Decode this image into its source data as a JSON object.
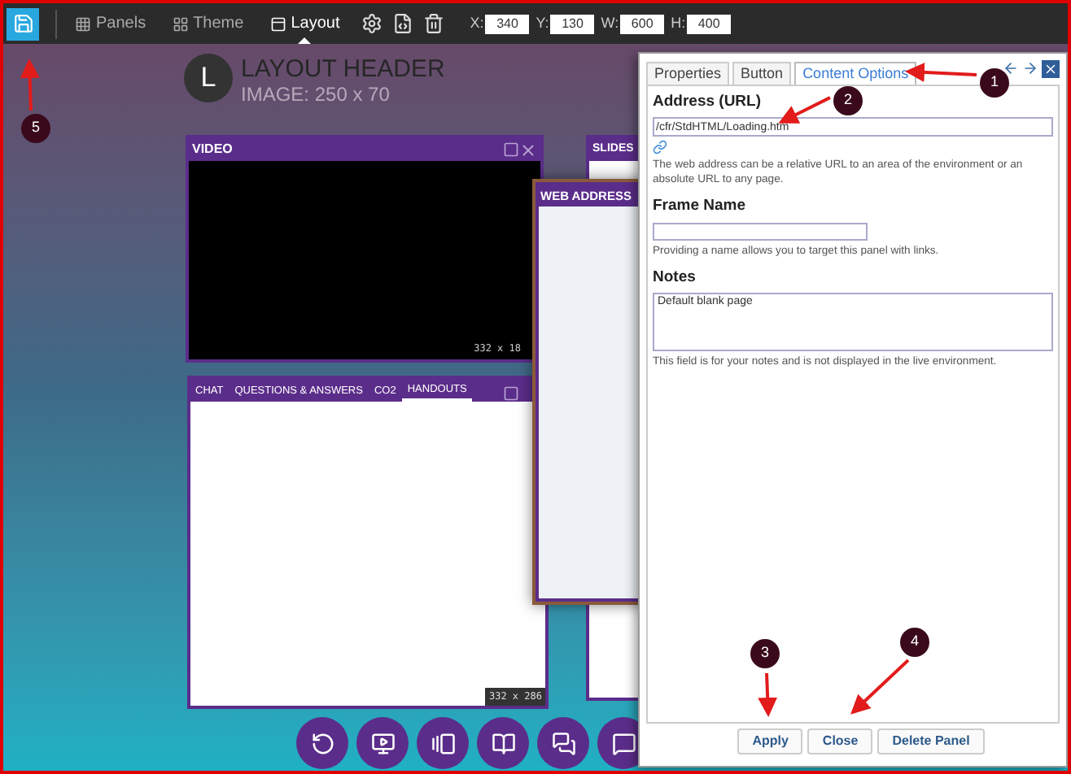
{
  "toolbar": {
    "tabs": [
      {
        "label": "Panels",
        "selected": false
      },
      {
        "label": "Theme",
        "selected": false
      },
      {
        "label": "Layout",
        "selected": true
      }
    ],
    "fields": [
      {
        "label": "X:",
        "value": "340"
      },
      {
        "label": "Y:",
        "value": "130"
      },
      {
        "label": "W:",
        "value": "600"
      },
      {
        "label": "H:",
        "value": "400"
      }
    ]
  },
  "header": {
    "logo_letter": "L",
    "title": "LAYOUT HEADER",
    "subtitle": "IMAGE: 250 x 70"
  },
  "video_panel": {
    "title": "VIDEO",
    "size": "332 x 18"
  },
  "chat_panel": {
    "tabs": [
      {
        "label": "CHAT",
        "selected": false
      },
      {
        "label": "QUESTIONS & ANSWERS",
        "selected": false
      },
      {
        "label": "CO2",
        "selected": false
      },
      {
        "label": "HANDOUTS",
        "selected": true
      }
    ],
    "size": "332 x 286"
  },
  "slides_panel": {
    "title": "SLIDES"
  },
  "web_address_panel": {
    "title": "WEB ADDRESS"
  },
  "dialog": {
    "tabs": [
      {
        "label": "Properties",
        "selected": false
      },
      {
        "label": "Button",
        "selected": false
      },
      {
        "label": "Content Options",
        "selected": true
      }
    ],
    "address": {
      "label": "Address (URL)",
      "value": "/cfr/StdHTML/Loading.htm",
      "help": "The web address can be a relative URL to an area of the environment or an absolute URL to any page."
    },
    "frame_name": {
      "label": "Frame Name",
      "help": "Providing a name allows you to target this panel with links."
    },
    "notes": {
      "label": "Notes",
      "value": "Default blank page",
      "help": "This field is for your notes and is not displayed in the live environment."
    },
    "buttons": [
      "Apply",
      "Close",
      "Delete Panel"
    ]
  },
  "callouts": [
    "1",
    "2",
    "3",
    "4",
    "5"
  ]
}
